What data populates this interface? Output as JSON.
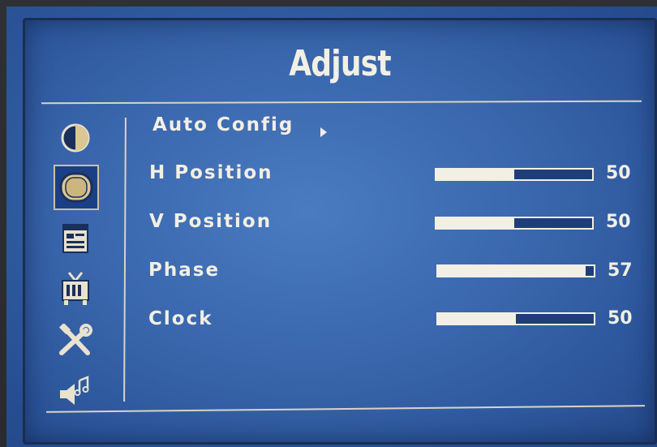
{
  "menu": {
    "title": "Adjust",
    "auto_config": {
      "label": "Auto Config"
    },
    "items": [
      {
        "label": "H Position",
        "value": "50",
        "level": 0.5
      },
      {
        "label": "V Position",
        "value": "50",
        "level": 0.5
      },
      {
        "label": "Phase",
        "value": "57",
        "level": 0.95
      },
      {
        "label": "Clock",
        "value": "50",
        "level": 0.5
      }
    ]
  },
  "sidebar": {
    "icons": [
      "brightness-contrast-icon",
      "display-adjust-icon",
      "window-settings-icon",
      "tv-icon",
      "tools-icon",
      "audio-icon"
    ],
    "selected_index": 1
  },
  "colors": {
    "osd_background": "#3a67ad",
    "text": "#f2efe4",
    "bar_empty": "#1f3e78"
  }
}
